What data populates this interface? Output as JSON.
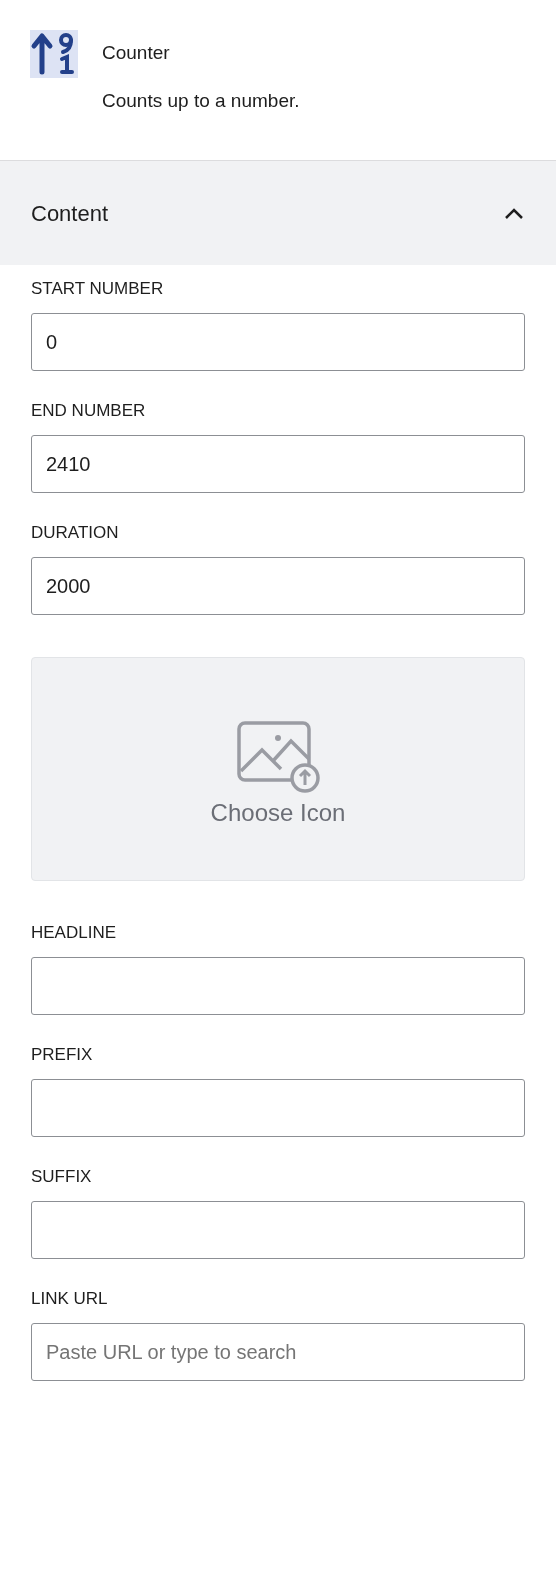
{
  "block": {
    "title": "Counter",
    "description": "Counts up to a number."
  },
  "panel": {
    "title": "Content",
    "expanded": true
  },
  "fields": [
    {
      "kind": "input",
      "label": "START NUMBER",
      "value": "0"
    },
    {
      "kind": "input",
      "label": "END NUMBER",
      "value": "2410"
    },
    {
      "kind": "input",
      "label": "DURATION",
      "value": "2000"
    },
    {
      "kind": "icon_picker",
      "label": "Choose Icon"
    },
    {
      "kind": "input",
      "label": "HEADLINE"
    },
    {
      "kind": "input",
      "label": "PREFIX"
    },
    {
      "kind": "input",
      "label": "SUFFIX"
    },
    {
      "kind": "input",
      "label": "LINK URL",
      "placeholder": "Paste URL or type to search"
    }
  ]
}
